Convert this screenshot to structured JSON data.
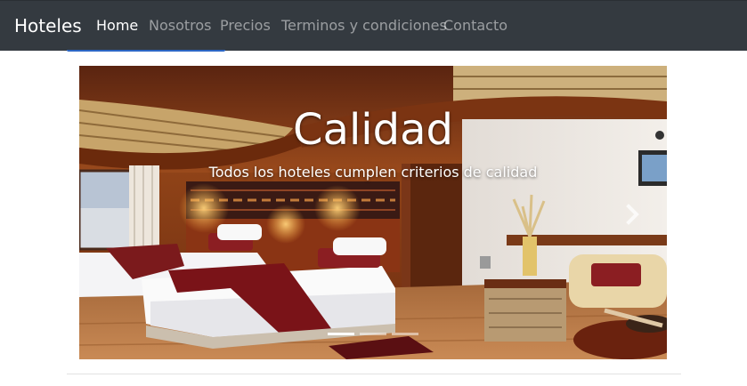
{
  "navbar": {
    "brand": "Hoteles",
    "links": [
      {
        "label": "Home",
        "active": true
      },
      {
        "label": "Nosotros",
        "active": false
      },
      {
        "label": "Precios",
        "active": false
      },
      {
        "label": "Terminos y condiciones",
        "active": false
      },
      {
        "label": "Contacto",
        "active": false
      }
    ]
  },
  "carousel": {
    "caption_title": "Calidad",
    "caption_text": "Todos los hoteles cumplen criterios de calidad",
    "slide_count": 3,
    "active_slide": 0,
    "next_icon": "chevron-right-icon"
  },
  "colors": {
    "navbar_bg": "#343a40",
    "nav_active": "#ffffff",
    "nav_inactive": "rgba(255,255,255,0.5)",
    "accent": "#2b66c4"
  }
}
